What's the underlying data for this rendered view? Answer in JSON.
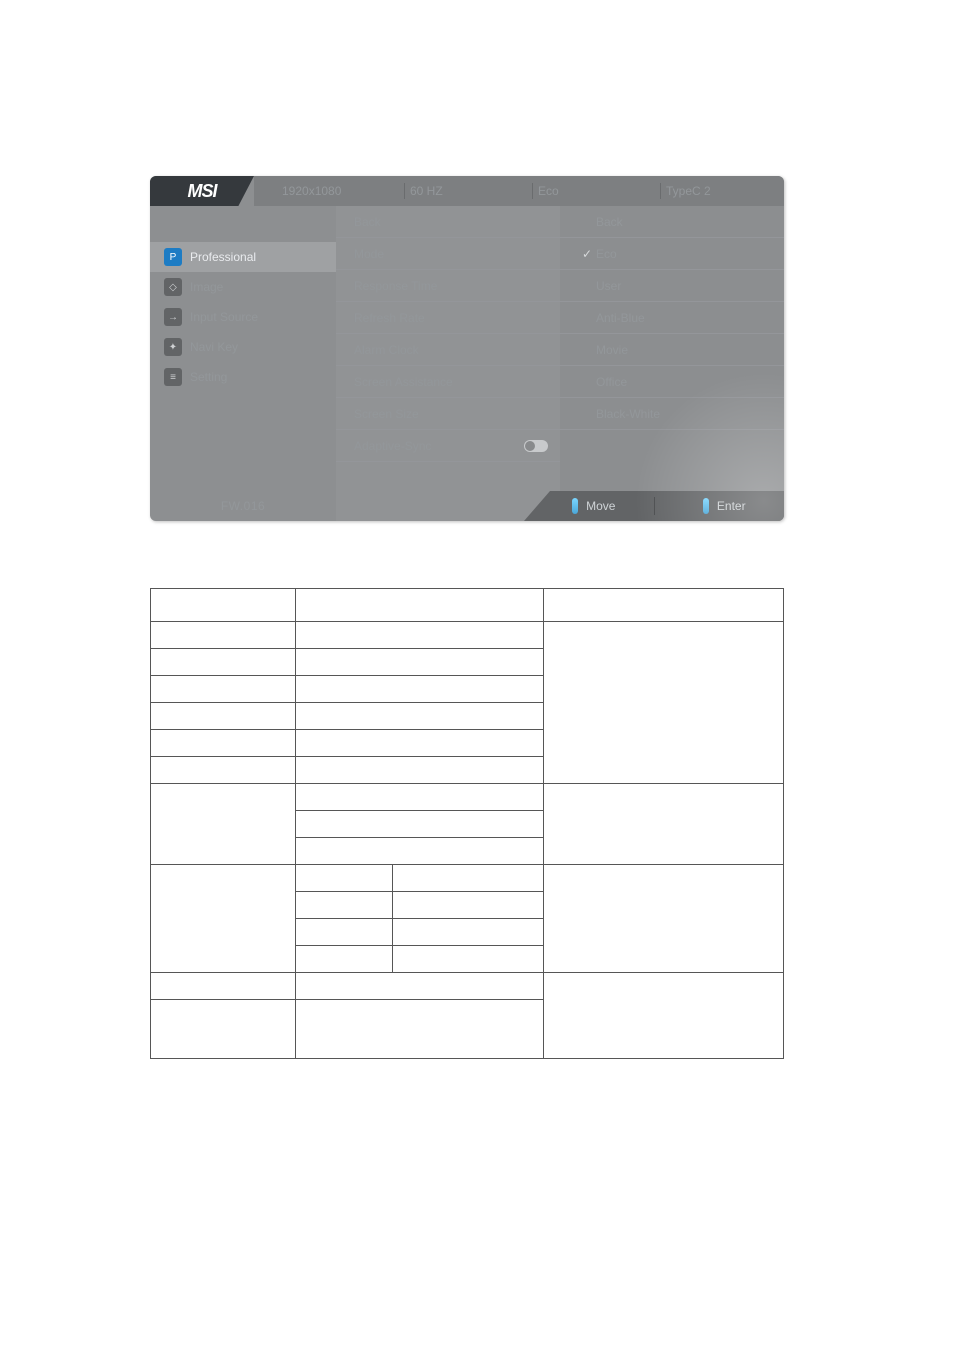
{
  "header": {
    "brand": "MSI",
    "resolution": "1920x1080",
    "refresh": "60 HZ",
    "preset": "Eco",
    "input": "TypeC 2"
  },
  "sidebar": {
    "items": [
      {
        "icon": "P",
        "label": "Professional",
        "active": true
      },
      {
        "icon": "◇",
        "label": "Image"
      },
      {
        "icon": "→",
        "label": "Input Source"
      },
      {
        "icon": "✦",
        "label": "Navi Key"
      },
      {
        "icon": "≡",
        "label": "Setting"
      }
    ]
  },
  "panel1": {
    "items": [
      {
        "label": "Back"
      },
      {
        "label": "Mode"
      },
      {
        "label": "Response Time"
      },
      {
        "label": "Refresh Rate"
      },
      {
        "label": "Alarm Clock"
      },
      {
        "label": "Screen Assistance"
      },
      {
        "label": "Screen Size"
      },
      {
        "label": "Adaptive-Sync",
        "toggle": true
      }
    ]
  },
  "panel2": {
    "items": [
      {
        "label": "Back"
      },
      {
        "label": "Eco",
        "selected": true
      },
      {
        "label": "User"
      },
      {
        "label": "Anti-Blue"
      },
      {
        "label": "Movie"
      },
      {
        "label": "Office"
      },
      {
        "label": "Black-White"
      }
    ]
  },
  "fw": "FW.016",
  "footer": {
    "move": "Move",
    "enter": "Enter"
  }
}
